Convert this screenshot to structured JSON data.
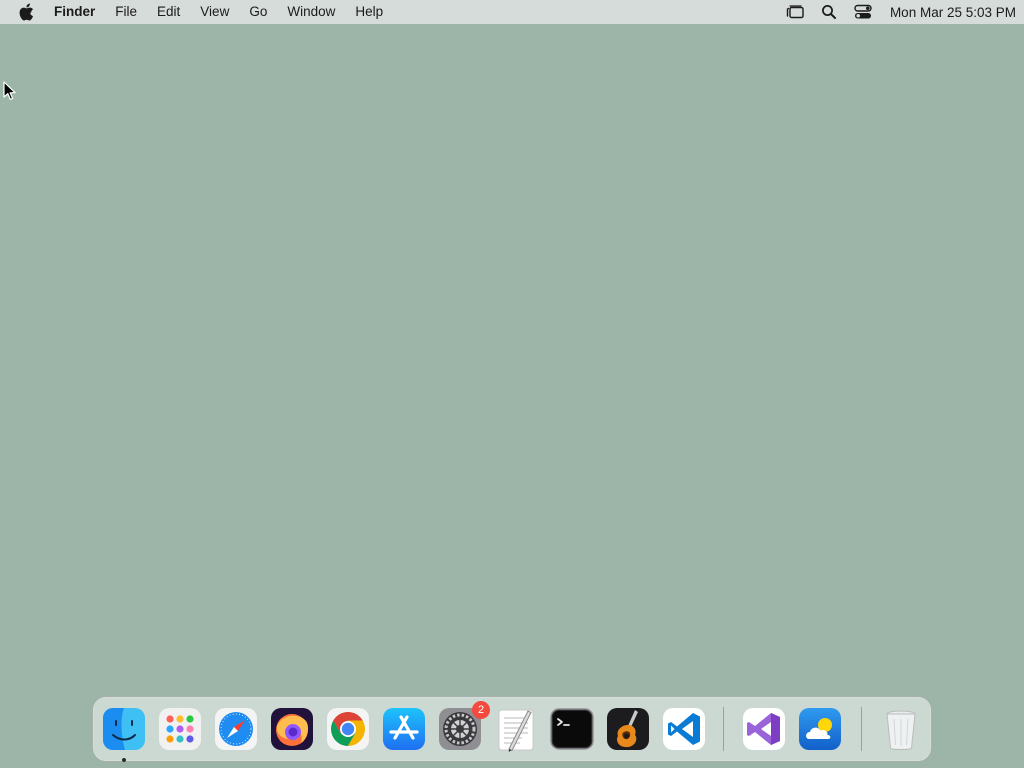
{
  "desktop": {
    "background": "#9db5a8"
  },
  "menubar": {
    "app_name": "Finder",
    "menus": [
      "File",
      "Edit",
      "View",
      "Go",
      "Window",
      "Help"
    ],
    "clock": "Mon Mar 25  5:03 PM",
    "status_icons": [
      "stage-manager-icon",
      "spotlight-search-icon",
      "control-center-icon"
    ]
  },
  "dock": {
    "apps": [
      {
        "name": "Finder",
        "icon": "finder-icon",
        "running": true
      },
      {
        "name": "Launchpad",
        "icon": "launchpad-icon"
      },
      {
        "name": "Safari",
        "icon": "safari-icon"
      },
      {
        "name": "Firefox",
        "icon": "firefox-icon"
      },
      {
        "name": "Google Chrome",
        "icon": "chrome-icon"
      },
      {
        "name": "App Store",
        "icon": "app-store-icon"
      },
      {
        "name": "System Settings",
        "icon": "system-settings-icon",
        "badge": "2"
      },
      {
        "name": "TextEdit",
        "icon": "textedit-icon"
      },
      {
        "name": "Terminal",
        "icon": "terminal-icon"
      },
      {
        "name": "GarageBand",
        "icon": "garageband-icon"
      },
      {
        "name": "Visual Studio Code",
        "icon": "vscode-icon"
      },
      {
        "name": "Visual Studio",
        "icon": "visual-studio-icon"
      },
      {
        "name": "Weather",
        "icon": "weather-icon"
      },
      {
        "name": "Trash",
        "icon": "trash-icon"
      }
    ]
  }
}
